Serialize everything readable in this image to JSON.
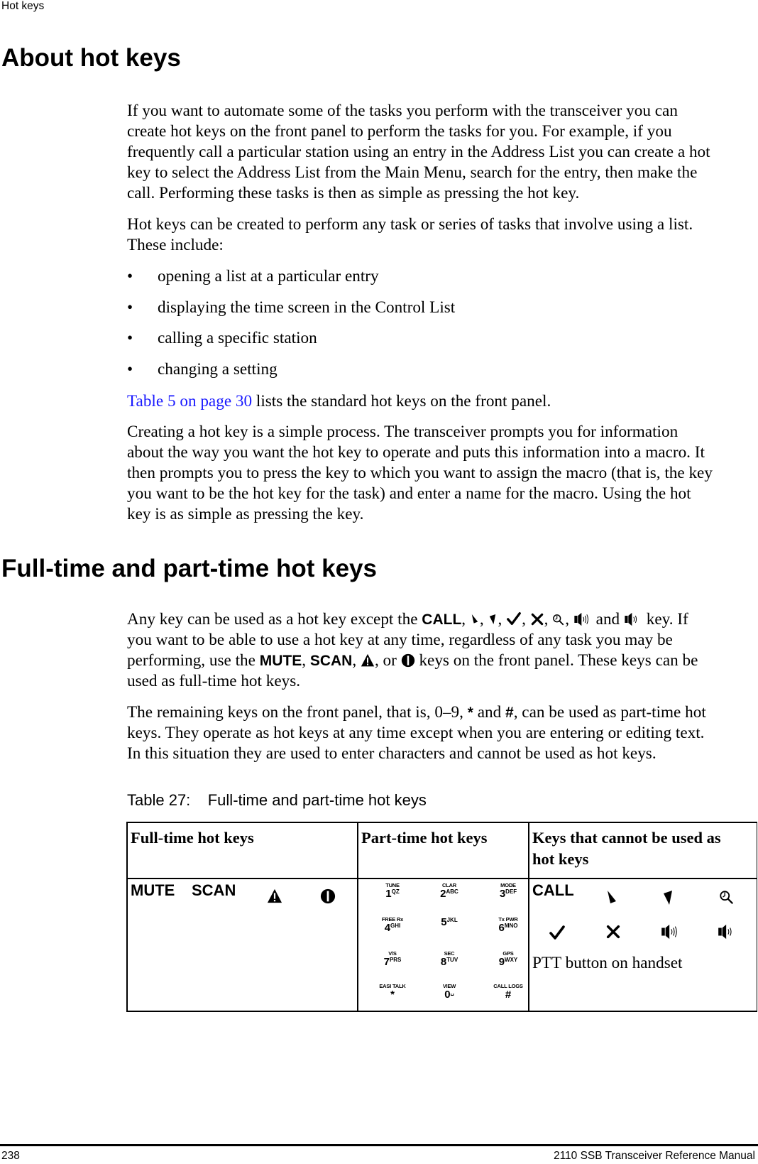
{
  "header": {
    "running_title": "Hot keys"
  },
  "section1": {
    "title": "About hot keys",
    "paragraphs": [
      [
        "If you want to automate some of the tasks you perform with the transceiver you can",
        "create hot keys on the front panel to perform the tasks for you. For example, if you",
        "frequently call a particular station using an entry in the Address List you can create a hot",
        "key to select the Address List from the Main Menu, search for the entry, then make the",
        "call. Performing these tasks is then as simple as pressing the hot key."
      ],
      [
        "Hot keys can be created to perform any task or series of tasks that involve using a list.",
        "These include:"
      ]
    ],
    "bullets": [
      "opening a list at a particular entry",
      "displaying the time screen in the Control List",
      "calling a specific station",
      "changing a setting"
    ],
    "bullet_char": "•",
    "xref": {
      "link_text": "Table 5 on page 30",
      "rest": " lists the standard hot keys on the front panel.",
      "link_color": "#1a1aff"
    },
    "creating": [
      "Creating a hot key is a simple process. The transceiver prompts you for information",
      "about the way you want the hot key to operate and puts this information into a macro. It",
      "then prompts you to press the key to which you want to assign the macro (that is, the key",
      "you want to be the hot key for the task) and enter a name for the macro. Using the hot",
      "key is as simple as pressing the key."
    ]
  },
  "section2": {
    "title": "Full-time and part-time hot keys",
    "p1": {
      "l1_pre": "Any key can be used as a hot key except the ",
      "call": "CALL",
      "and": " and ",
      "l1_post": " key. If",
      "l2": "you want to be able to use a hot key at any time, regardless of any task you may be",
      "l3_pre": "performing, use the ",
      "mute": "MUTE",
      "scan": "SCAN",
      "or": ", or ",
      "l3_post": " keys on the front panel. These keys can be",
      "l4": "used as full-time hot keys."
    },
    "p2": {
      "l1_pre": "The remaining keys on the front panel, that is, 0–9, ",
      "star": "*",
      "and": " and ",
      "hash": "#",
      "l1_post": ", can be used as part-time hot",
      "l2": "keys. They operate as hot keys at any time except when you are entering or editing text.",
      "l3": "In this situation they are used to enter characters and cannot be used as hot keys."
    }
  },
  "table": {
    "caption": "Table 27:    Full-time and part-time hot keys",
    "headers": [
      "Full-time hot keys",
      "Part-time hot keys",
      "Keys that cannot be used as hot keys"
    ],
    "full_time": {
      "keys": [
        "MUTE",
        "SCAN"
      ],
      "icons": [
        "warning-triangle-icon",
        "emergency-circle-icon"
      ]
    },
    "part_time": [
      {
        "label": "TUNE",
        "num": "1",
        "letters": "QZ"
      },
      {
        "label": "CLAR",
        "num": "2",
        "letters": "ABC"
      },
      {
        "label": "MODE",
        "num": "3",
        "letters": "DEF"
      },
      {
        "label": "FREE Rx",
        "num": "4",
        "letters": "GHI"
      },
      {
        "label": "",
        "num": "5",
        "letters": "JKL"
      },
      {
        "label": "Tx PWR",
        "num": "6",
        "letters": "MNO"
      },
      {
        "label": "V/S",
        "num": "7",
        "letters": "PRS"
      },
      {
        "label": "SEC",
        "num": "8",
        "letters": "TUV"
      },
      {
        "label": "GPS",
        "num": "9",
        "letters": "WXY"
      },
      {
        "label": "EASI TALK",
        "num": "*",
        "letters": ""
      },
      {
        "label": "VIEW",
        "num": "0",
        "letters": "␣"
      },
      {
        "label": "CALL LOGS",
        "num": "#",
        "letters": ""
      }
    ],
    "cannot": {
      "call": "CALL",
      "icons": [
        "arrow-down-right-icon",
        "arrow-down-left-icon",
        "search-icon",
        "check-icon",
        "cross-icon",
        "volume-up-icon",
        "volume-down-icon"
      ],
      "ptt": "PTT button on handset"
    }
  },
  "footer": {
    "page_number": "238",
    "manual_title": "2110 SSB Transceiver Reference Manual"
  }
}
